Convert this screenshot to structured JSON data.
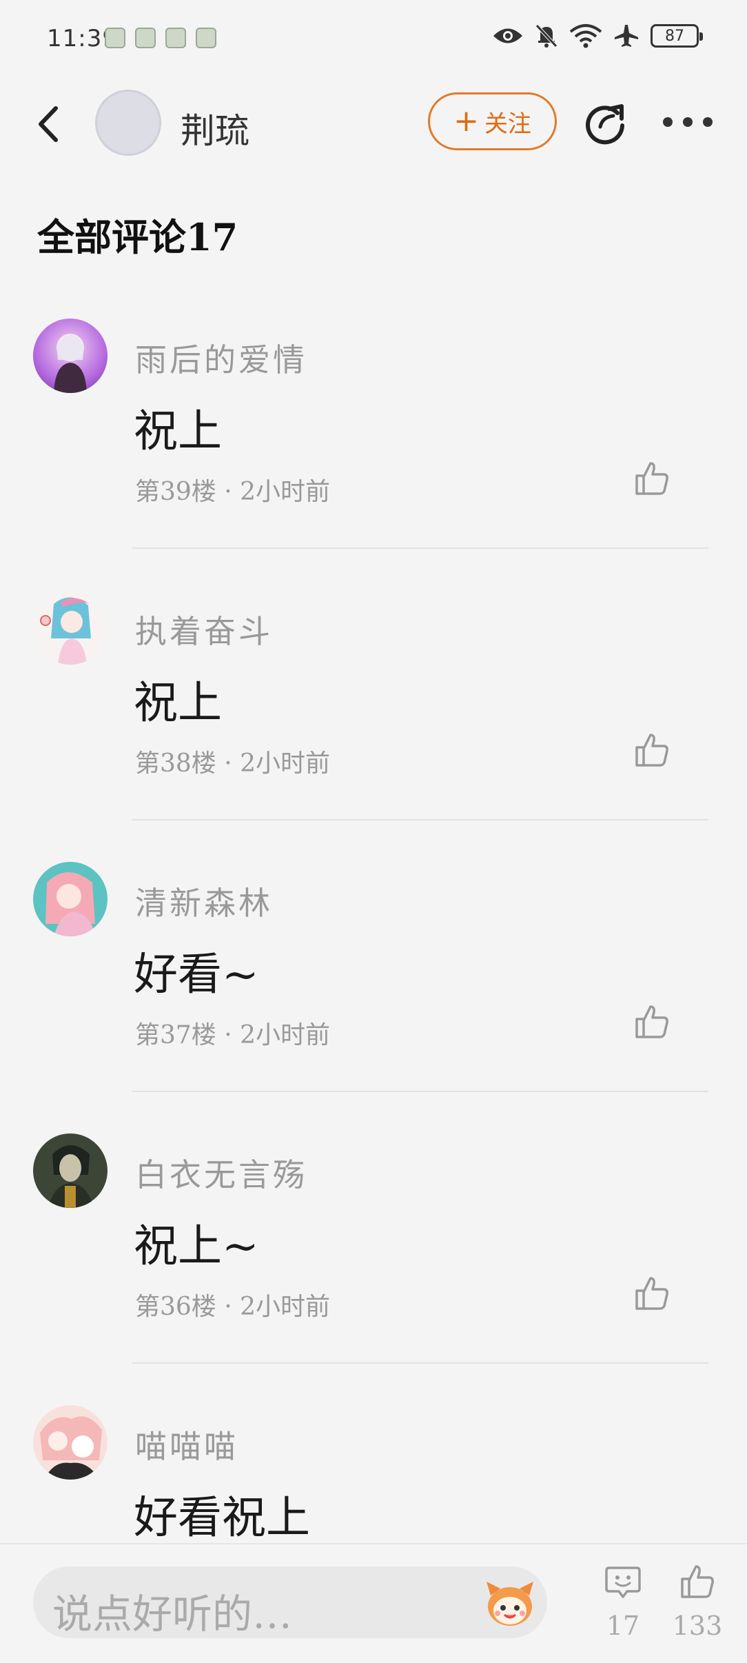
{
  "status_bar": {
    "time": "11:39",
    "battery": "87"
  },
  "header": {
    "username": "荆琉",
    "follow_label": "关注",
    "follow_plus": "+"
  },
  "section_title": "全部评论17",
  "comments": [
    {
      "name": "雨后的爱情",
      "text": "祝上",
      "meta": "第39楼 · 2小时前",
      "avatar_colors": [
        "#b56be0",
        "#f3d2f0"
      ]
    },
    {
      "name": "执着奋斗",
      "text": "祝上",
      "meta": "第38楼 · 2小时前",
      "avatar_colors": [
        "#6cc3d9",
        "#f7c9dc"
      ]
    },
    {
      "name": "清新森林",
      "text": "好看~",
      "meta": "第37楼 · 2小时前",
      "avatar_colors": [
        "#5cc3c2",
        "#f4b6c3"
      ]
    },
    {
      "name": "白衣无言殇",
      "text": "祝上~",
      "meta": "第36楼 · 2小时前",
      "avatar_colors": [
        "#3d4636",
        "#8c9a76"
      ]
    },
    {
      "name": "喵喵喵",
      "text": "好看祝上",
      "meta": "",
      "avatar_colors": [
        "#f5b8b8",
        "#fbe3dc"
      ]
    }
  ],
  "bottom_bar": {
    "input_placeholder": "说点好听的…",
    "comment_count": "17",
    "like_count": "133"
  },
  "colors": {
    "accent": "#e06b12",
    "background": "#f4f4f4"
  }
}
